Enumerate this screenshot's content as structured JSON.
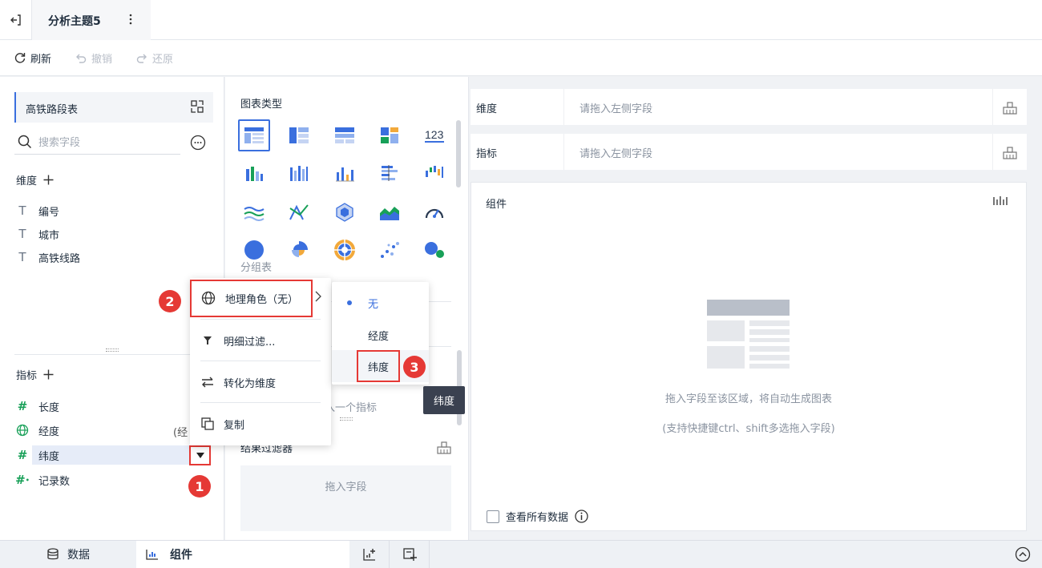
{
  "header": {
    "title": "分析主题5"
  },
  "toolbar": {
    "refresh": "刷新",
    "undo": "撤销",
    "redo": "还原"
  },
  "left": {
    "dataset": "高铁路段表",
    "search_placeholder": "搜索字段",
    "dimension_title": "维度",
    "dimensions": [
      "编号",
      "城市",
      "高铁线路"
    ],
    "metric_title": "指标",
    "metrics": [
      "长度",
      "经度",
      "纬度",
      "记录数"
    ],
    "jing_suffix": "(经"
  },
  "middle": {
    "chart_type_title": "图表类型",
    "group_label": "分组表",
    "metric_placeholder": "入一个指标",
    "result_filter": "结果过滤器",
    "drop_field": "拖入字段"
  },
  "right": {
    "dim_label": "维度",
    "dim_placeholder": "请拖入左侧字段",
    "metric_label": "指标",
    "metric_placeholder": "请拖入左侧字段",
    "widget_title": "组件",
    "empty_line1": "拖入字段至该区域，将自动生成图表",
    "empty_line2": "(支持快捷键ctrl、shift多选拖入字段)",
    "view_all": "查看所有数据"
  },
  "context_menu": {
    "geo_role": "地理角色（无）",
    "detail_filter": "明细过滤...",
    "convert": "转化为维度",
    "copy": "复制"
  },
  "sub_menu": {
    "none": "无",
    "longitude": "经度",
    "latitude": "纬度"
  },
  "tooltip": "纬度",
  "badges": [
    "1",
    "2",
    "3"
  ],
  "bottom": {
    "tab_data": "数据",
    "tab_widget": "组件"
  },
  "colors": {
    "accent": "#3a6fde",
    "highlight": "#e53935",
    "green": "#18a058"
  }
}
